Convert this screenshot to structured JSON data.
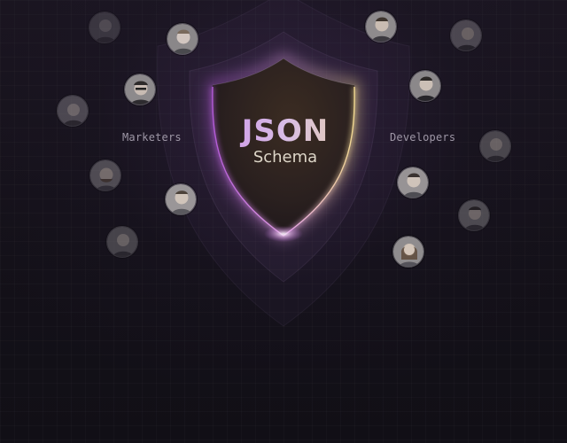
{
  "shield": {
    "title": "JSON",
    "subtitle": "Schema"
  },
  "groups": {
    "left_label": "Marketers",
    "right_label": "Developers"
  },
  "colors": {
    "accent_purple": "#c98be8",
    "accent_gold": "#e6d39a",
    "background": "#110f17"
  }
}
